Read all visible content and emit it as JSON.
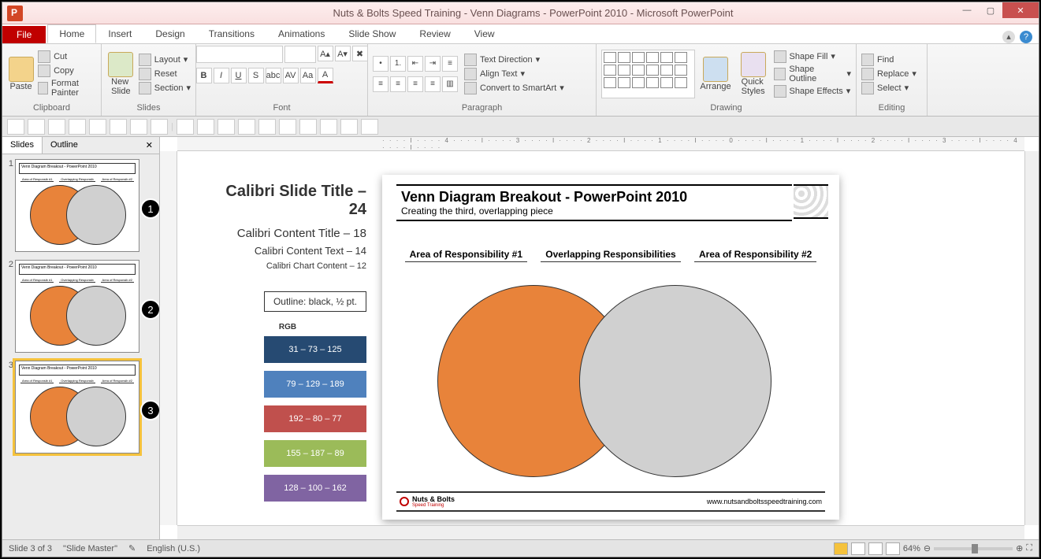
{
  "window": {
    "title": "Nuts & Bolts Speed Training - Venn Diagrams - PowerPoint 2010  -  Microsoft PowerPoint",
    "min": "—",
    "max": "▢",
    "close": "✕"
  },
  "tabs": {
    "file": "File",
    "home": "Home",
    "insert": "Insert",
    "design": "Design",
    "transitions": "Transitions",
    "animations": "Animations",
    "slideshow": "Slide Show",
    "review": "Review",
    "view": "View"
  },
  "ribbon": {
    "clipboard": {
      "paste": "Paste",
      "cut": "Cut",
      "copy": "Copy",
      "format": "Format Painter",
      "label": "Clipboard"
    },
    "slides": {
      "new": "New\nSlide",
      "layout": "Layout",
      "reset": "Reset",
      "section": "Section",
      "label": "Slides"
    },
    "font": {
      "label": "Font"
    },
    "paragraph": {
      "textdir": "Text Direction",
      "align": "Align Text",
      "convert": "Convert to SmartArt",
      "label": "Paragraph"
    },
    "drawing": {
      "arrange": "Arrange",
      "quick": "Quick\nStyles",
      "fill": "Shape Fill",
      "outline": "Shape Outline",
      "effects": "Shape Effects",
      "label": "Drawing"
    },
    "editing": {
      "find": "Find",
      "replace": "Replace",
      "select": "Select",
      "label": "Editing"
    }
  },
  "panel": {
    "slides": "Slides",
    "outline": "Outline",
    "x": "✕"
  },
  "thumbs": [
    {
      "n": "1",
      "title": "Venn Diagram Breakout - PowerPoint 2010"
    },
    {
      "n": "2",
      "title": "Venn Diagram Breakout - PowerPoint 2010"
    },
    {
      "n": "3",
      "title": "Venn Diagram Breakout - PowerPoint 2010"
    }
  ],
  "legend": {
    "t1": "Calibri  Slide Title – 24",
    "t2": "Calibri Content Title – 18",
    "t3": "Calibri Content Text – 14",
    "t4": "Calibri  Chart  Content – 12",
    "outline": "Outline: black, ½ pt.",
    "rgb": "RGB",
    "swatches": [
      {
        "t": "31 – 73 – 125",
        "c": "#264a72"
      },
      {
        "t": "79 – 129 – 189",
        "c": "#4f81bd"
      },
      {
        "t": "192 – 80 – 77",
        "c": "#c0504d"
      },
      {
        "t": "155 – 187 – 89",
        "c": "#9bbb59"
      },
      {
        "t": "128 – 100 – 162",
        "c": "#8064a2"
      }
    ]
  },
  "slide": {
    "title": "Venn Diagram Breakout - PowerPoint 2010",
    "subtitle": "Creating the third, overlapping piece",
    "l1": "Area of Responsibility #1",
    "l2": "Overlapping Responsibilities",
    "l3": "Area of Responsibility #2",
    "brand": "Nuts & Bolts",
    "brandsub": "Speed Training",
    "url": "www.nutsandboltsspeedtraining.com"
  },
  "ruler": "· · · · I · · · · 4 · · · · I · · · · 3 · · · · I · · · · 2 · · · · I · · · · 1 · · · · I · · · · 0 · · · · I · · · · 1 · · · · I · · · · 2 · · · · I · · · · 3 · · · · I · · · · 4 · · · · I · · · ·",
  "status": {
    "slide": "Slide 3 of 3",
    "master": "\"Slide Master\"",
    "lang": "English (U.S.)",
    "zoom": "64%"
  }
}
